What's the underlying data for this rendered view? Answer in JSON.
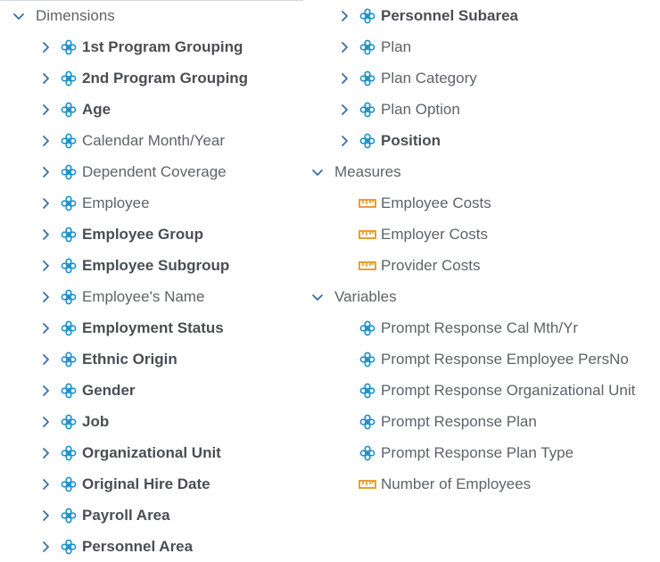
{
  "tree": {
    "left": {
      "section": {
        "label": "Dimensions",
        "expanded": true
      },
      "items": [
        {
          "label": "1st Program Grouping",
          "bold": true,
          "icon": "dimension-icon"
        },
        {
          "label": "2nd Program Grouping",
          "bold": true,
          "icon": "dimension-icon"
        },
        {
          "label": "Age",
          "bold": true,
          "icon": "dimension-icon"
        },
        {
          "label": "Calendar Month/Year",
          "bold": false,
          "icon": "dimension-icon"
        },
        {
          "label": "Dependent Coverage",
          "bold": false,
          "icon": "dimension-icon"
        },
        {
          "label": "Employee",
          "bold": false,
          "icon": "dimension-icon"
        },
        {
          "label": "Employee Group",
          "bold": true,
          "icon": "dimension-icon"
        },
        {
          "label": "Employee Subgroup",
          "bold": true,
          "icon": "dimension-icon"
        },
        {
          "label": "Employee's Name",
          "bold": false,
          "icon": "dimension-icon"
        },
        {
          "label": "Employment Status",
          "bold": true,
          "icon": "dimension-icon"
        },
        {
          "label": "Ethnic Origin",
          "bold": true,
          "icon": "dimension-icon"
        },
        {
          "label": "Gender",
          "bold": true,
          "icon": "dimension-icon"
        },
        {
          "label": "Job",
          "bold": true,
          "icon": "dimension-icon"
        },
        {
          "label": "Organizational Unit",
          "bold": true,
          "icon": "dimension-icon"
        },
        {
          "label": "Original Hire Date",
          "bold": true,
          "icon": "dimension-icon"
        },
        {
          "label": "Payroll Area",
          "bold": true,
          "icon": "dimension-icon"
        },
        {
          "label": "Personnel Area",
          "bold": true,
          "icon": "dimension-icon"
        }
      ]
    },
    "right": {
      "dimension_items": [
        {
          "label": "Personnel Subarea",
          "bold": true,
          "icon": "dimension-icon"
        },
        {
          "label": "Plan",
          "bold": false,
          "icon": "dimension-icon"
        },
        {
          "label": "Plan Category",
          "bold": false,
          "icon": "dimension-icon"
        },
        {
          "label": "Plan Option",
          "bold": false,
          "icon": "dimension-icon"
        },
        {
          "label": "Position",
          "bold": true,
          "icon": "dimension-icon"
        }
      ],
      "measures": {
        "label": "Measures",
        "expanded": true,
        "items": [
          {
            "label": "Employee Costs",
            "icon": "measure-icon"
          },
          {
            "label": "Employer Costs",
            "icon": "measure-icon"
          },
          {
            "label": "Provider Costs",
            "icon": "measure-icon"
          }
        ]
      },
      "variables": {
        "label": "Variables",
        "expanded": true,
        "items": [
          {
            "label": "Prompt Response Cal Mth/Yr",
            "icon": "dimension-icon"
          },
          {
            "label": "Prompt Response Employee PersNo",
            "icon": "dimension-icon"
          },
          {
            "label": "Prompt Response Organizational Unit",
            "icon": "dimension-icon"
          },
          {
            "label": "Prompt Response Plan",
            "icon": "dimension-icon"
          },
          {
            "label": "Prompt Response Plan Type",
            "icon": "dimension-icon"
          },
          {
            "label": "Number of Employees",
            "icon": "measure-icon"
          }
        ]
      }
    },
    "colors": {
      "dimension_icon": "#1a8fc8",
      "measure_icon": "#e7951e",
      "chevron": "#3b6ea1",
      "text": "#5e6369",
      "text_bold": "#4a4e53"
    }
  }
}
